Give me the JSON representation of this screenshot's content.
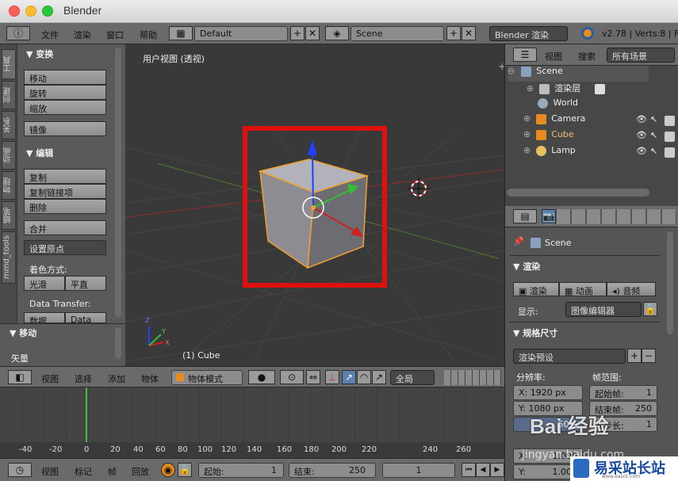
{
  "window": {
    "title": "Blender"
  },
  "topbar": {
    "menus": [
      "文件",
      "渲染",
      "窗口",
      "帮助"
    ],
    "layout_name": "Default",
    "scene_name": "Scene",
    "engine": "Blender 渲染",
    "stats": "v2.78 | Verts:8 | Fa"
  },
  "toolshelf": {
    "tabs": [
      "工具",
      "创建",
      "关系",
      "动画",
      "物理",
      "蜡笔",
      "mmd_tools"
    ],
    "transform_header": "▼ 变换",
    "transform_buttons": [
      "移动",
      "旋转",
      "缩放"
    ],
    "mirror": "镜像",
    "edit_header": "▼ 编辑",
    "edit_buttons": [
      "复制",
      "复制链接项",
      "删除"
    ],
    "join": "合并",
    "set_origin": "设置原点",
    "shading_label": "着色方式:",
    "smooth": "光滑",
    "flat": "平直",
    "data_transfer_label": "Data Transfer:",
    "data": "数据",
    "data_la": "Data La",
    "move_header": "▼ 移动",
    "vector_label": "矢量"
  },
  "viewport": {
    "view_label": "用户视图 (透视)",
    "object_label": "(1) Cube",
    "axis_z": "Z",
    "axis_x": "X",
    "axis_y": "Y"
  },
  "viewport_header": {
    "menus": [
      "视图",
      "选择",
      "添加",
      "物体"
    ],
    "mode": "物体模式",
    "pivot": "全局"
  },
  "timeline": {
    "ticks": [
      "-40",
      "-20",
      "0",
      "20",
      "40",
      "60",
      "80",
      "100",
      "120",
      "140",
      "160",
      "180",
      "200",
      "220",
      "240",
      "260"
    ],
    "header_menus": [
      "视图",
      "标记",
      "帧",
      "回放"
    ],
    "start_label": "起始:",
    "start_value": "1",
    "end_label": "结束:",
    "end_value": "250",
    "current_frame": "1"
  },
  "outliner": {
    "menus": [
      "视图",
      "搜索"
    ],
    "filter": "所有场景",
    "rows": [
      {
        "label": "Scene"
      },
      {
        "label": "渲染层"
      },
      {
        "label": "World"
      },
      {
        "label": "Camera"
      },
      {
        "label": "Cube"
      },
      {
        "label": "Lamp"
      }
    ]
  },
  "properties": {
    "scene_label": "Scene",
    "render_header": "▼ 渲染",
    "render_buttons": [
      "渲染",
      "动画",
      "音频"
    ],
    "display_label": "显示:",
    "display_value": "图像编辑器",
    "dimensions_header": "▼ 规格尺寸",
    "render_preset": "渲染预设",
    "resolution_label": "分辨率:",
    "res_x": "X: 1920 px",
    "res_y": "Y: 1080 px",
    "res_pct": "50%",
    "frame_range_label": "帧范围:",
    "frame_start": "起始帧:",
    "frame_start_val": "1",
    "frame_end": "结束帧:",
    "frame_end_val": "250",
    "frame_step": "帧步长:",
    "frame_step_val": "1",
    "aspect_x": "X:",
    "aspect_x_val": "1.000",
    "aspect_y": "Y:",
    "aspect_y_val": "1.000"
  },
  "watermarks": {
    "baidu": "Bai 经验",
    "baidu_sub": "jingyan.baidu.com",
    "site": "易采站长站",
    "site_sub": "www.easck.com"
  },
  "colors": {
    "selection_box": "#e01010",
    "selected_outline": "#f0a030",
    "axis_x": "#d02020",
    "axis_y": "#30c030",
    "axis_z": "#2040ff",
    "current_frame": "#40c040"
  }
}
